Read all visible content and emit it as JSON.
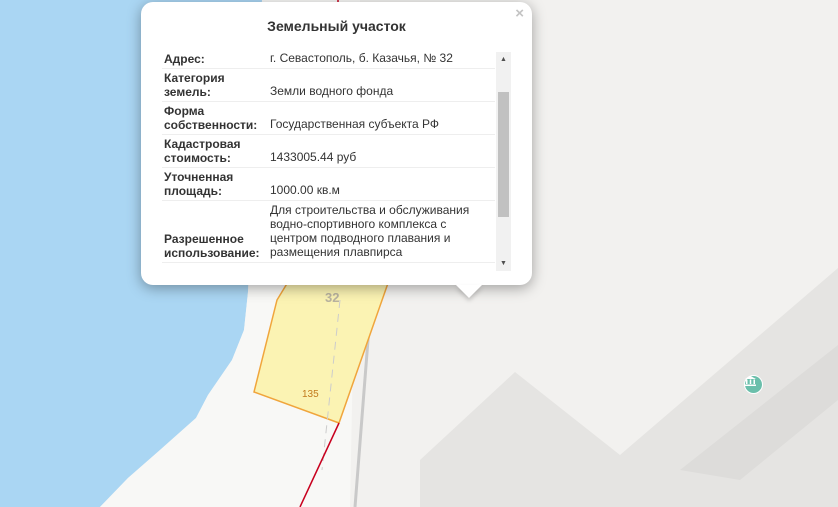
{
  "popup": {
    "title": "Земельный участок",
    "close_icon": "×",
    "rows": [
      {
        "key": "Адрес:",
        "value": "г. Севастополь, б. Казачья, № 32"
      },
      {
        "key": "Категория земель:",
        "value": "Земли водного фонда"
      },
      {
        "key": "Форма собственности:",
        "value": "Государственная субъекта РФ"
      },
      {
        "key": "Кадастровая стоимость:",
        "value": "1433005.44 руб"
      },
      {
        "key": "Уточненная площадь:",
        "value": "1000.00 кв.м"
      },
      {
        "key": "Разрешенное использование:",
        "value": "Для строительства и обслуживания водно-спортивного комплекса с центром подводного плавания и размещения плавпирса"
      }
    ],
    "scroll_up_icon": "▲",
    "scroll_down_icon": "▼"
  },
  "map": {
    "parcel_number": "32",
    "parcel_sublabel": "135",
    "poi_icon": "museum-icon",
    "colors": {
      "water": "#aad6f3",
      "land": "#f2f1ef",
      "parcel_fill": "#fbf3b3",
      "parcel_stroke": "#f0a53c",
      "boundary": "#c8001e",
      "poi": "#6bbfab"
    }
  }
}
